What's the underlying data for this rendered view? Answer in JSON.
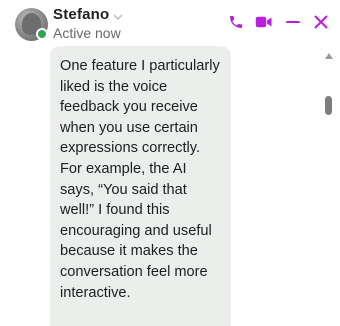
{
  "header": {
    "contact_name": "Stefano",
    "status": "Active now",
    "accent_color": "#b71fdc",
    "status_color": "#31a24c",
    "icons": [
      "phone-icon",
      "video-camera-icon",
      "minimize-icon",
      "close-icon"
    ]
  },
  "message": {
    "text": "One feature I particularly liked is the voice feedback you receive when you use certain expressions correctly. For example, the AI says, “You said that well!” I found this encouraging and useful because it makes the conversation feel more interactive."
  }
}
